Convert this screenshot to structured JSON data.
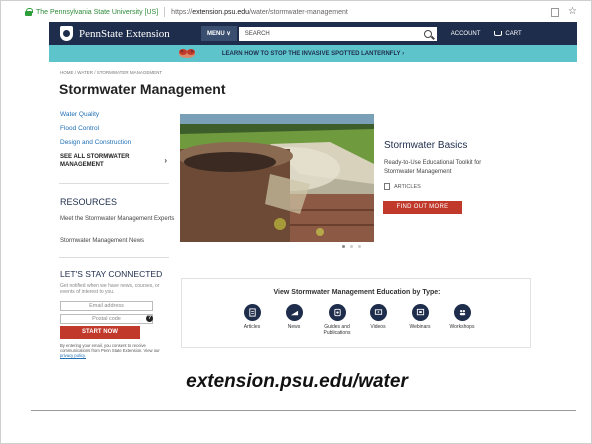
{
  "browser": {
    "site_owner": "The Pennsylvania State University [US]",
    "url_prefix": "https://",
    "url_host": "extension.psu.edu",
    "url_path": "/water/stormwater-management"
  },
  "header": {
    "brand": "PennState Extension",
    "menu_label": "MENU",
    "search_placeholder": "SEARCH",
    "account_label": "ACCOUNT",
    "cart_label": "CART"
  },
  "banner": {
    "text": "LEARN HOW TO STOP THE INVASIVE SPOTTED LANTERNFLY  ›"
  },
  "breadcrumb": "HOME  /  WATER  /  STORMWATER MANAGEMENT",
  "page_title": "Stormwater Management",
  "sidebar": {
    "links": [
      "Water Quality",
      "Flood Control",
      "Design and Construction"
    ],
    "see_all_line1": "SEE ALL STORMWATER",
    "see_all_line2": "MANAGEMENT",
    "see_all_chevron": "›",
    "resources_title": "RESOURCES",
    "resources": [
      "Meet the Stormwater Management Experts",
      "Stormwater Management News"
    ],
    "connect_title": "LET'S STAY CONNECTED",
    "connect_subtitle": "Get notified when we have news, courses, or events of interest to you.",
    "email_placeholder": "Email address",
    "postal_placeholder": "Postal code",
    "help_glyph": "?",
    "start_now": "START NOW",
    "legal_text": "By entering your email, you consent to receive communications from Penn State Extension. View our",
    "privacy_link": "privacy policy."
  },
  "hero": {
    "title": "Stormwater Basics",
    "description": "Ready-to-Use Educational Toolkit for Stormwater Management",
    "tag": "ARTICLES",
    "cta": "FIND OUT MORE",
    "slide_count": 3,
    "active_slide": 1
  },
  "education": {
    "title": "View Stormwater Management Education by Type:",
    "types": [
      {
        "label": "Articles",
        "icon": "article-icon"
      },
      {
        "label": "News",
        "icon": "news-icon"
      },
      {
        "label": "Guides and Publications",
        "icon": "guides-icon"
      },
      {
        "label": "Videos",
        "icon": "videos-icon"
      },
      {
        "label": "Webinars",
        "icon": "webinars-icon"
      },
      {
        "label": "Workshops",
        "icon": "workshops-icon"
      }
    ]
  },
  "caption": "extension.psu.edu/water",
  "colors": {
    "navy": "#1e2d4b",
    "teal_banner": "#5ec4cc",
    "cta_red": "#c0392b",
    "link_blue": "#1f6fb5",
    "secure_green": "#2e8b3a"
  }
}
